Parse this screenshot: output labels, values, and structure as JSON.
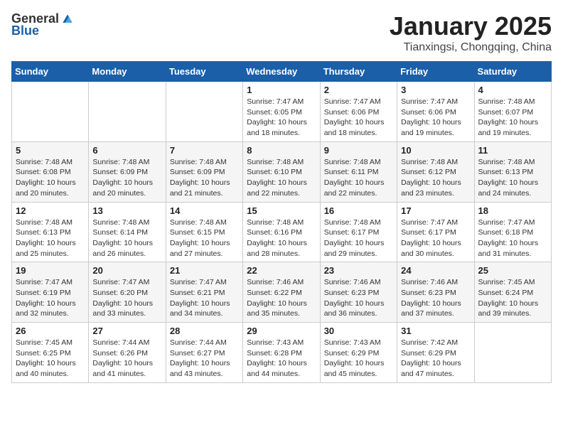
{
  "header": {
    "logo_general": "General",
    "logo_blue": "Blue",
    "month": "January 2025",
    "location": "Tianxingsi, Chongqing, China"
  },
  "weekdays": [
    "Sunday",
    "Monday",
    "Tuesday",
    "Wednesday",
    "Thursday",
    "Friday",
    "Saturday"
  ],
  "weeks": [
    [
      {
        "day": "",
        "info": ""
      },
      {
        "day": "",
        "info": ""
      },
      {
        "day": "",
        "info": ""
      },
      {
        "day": "1",
        "info": "Sunrise: 7:47 AM\nSunset: 6:05 PM\nDaylight: 10 hours\nand 18 minutes."
      },
      {
        "day": "2",
        "info": "Sunrise: 7:47 AM\nSunset: 6:06 PM\nDaylight: 10 hours\nand 18 minutes."
      },
      {
        "day": "3",
        "info": "Sunrise: 7:47 AM\nSunset: 6:06 PM\nDaylight: 10 hours\nand 19 minutes."
      },
      {
        "day": "4",
        "info": "Sunrise: 7:48 AM\nSunset: 6:07 PM\nDaylight: 10 hours\nand 19 minutes."
      }
    ],
    [
      {
        "day": "5",
        "info": "Sunrise: 7:48 AM\nSunset: 6:08 PM\nDaylight: 10 hours\nand 20 minutes."
      },
      {
        "day": "6",
        "info": "Sunrise: 7:48 AM\nSunset: 6:09 PM\nDaylight: 10 hours\nand 20 minutes."
      },
      {
        "day": "7",
        "info": "Sunrise: 7:48 AM\nSunset: 6:09 PM\nDaylight: 10 hours\nand 21 minutes."
      },
      {
        "day": "8",
        "info": "Sunrise: 7:48 AM\nSunset: 6:10 PM\nDaylight: 10 hours\nand 22 minutes."
      },
      {
        "day": "9",
        "info": "Sunrise: 7:48 AM\nSunset: 6:11 PM\nDaylight: 10 hours\nand 22 minutes."
      },
      {
        "day": "10",
        "info": "Sunrise: 7:48 AM\nSunset: 6:12 PM\nDaylight: 10 hours\nand 23 minutes."
      },
      {
        "day": "11",
        "info": "Sunrise: 7:48 AM\nSunset: 6:13 PM\nDaylight: 10 hours\nand 24 minutes."
      }
    ],
    [
      {
        "day": "12",
        "info": "Sunrise: 7:48 AM\nSunset: 6:13 PM\nDaylight: 10 hours\nand 25 minutes."
      },
      {
        "day": "13",
        "info": "Sunrise: 7:48 AM\nSunset: 6:14 PM\nDaylight: 10 hours\nand 26 minutes."
      },
      {
        "day": "14",
        "info": "Sunrise: 7:48 AM\nSunset: 6:15 PM\nDaylight: 10 hours\nand 27 minutes."
      },
      {
        "day": "15",
        "info": "Sunrise: 7:48 AM\nSunset: 6:16 PM\nDaylight: 10 hours\nand 28 minutes."
      },
      {
        "day": "16",
        "info": "Sunrise: 7:48 AM\nSunset: 6:17 PM\nDaylight: 10 hours\nand 29 minutes."
      },
      {
        "day": "17",
        "info": "Sunrise: 7:47 AM\nSunset: 6:17 PM\nDaylight: 10 hours\nand 30 minutes."
      },
      {
        "day": "18",
        "info": "Sunrise: 7:47 AM\nSunset: 6:18 PM\nDaylight: 10 hours\nand 31 minutes."
      }
    ],
    [
      {
        "day": "19",
        "info": "Sunrise: 7:47 AM\nSunset: 6:19 PM\nDaylight: 10 hours\nand 32 minutes."
      },
      {
        "day": "20",
        "info": "Sunrise: 7:47 AM\nSunset: 6:20 PM\nDaylight: 10 hours\nand 33 minutes."
      },
      {
        "day": "21",
        "info": "Sunrise: 7:47 AM\nSunset: 6:21 PM\nDaylight: 10 hours\nand 34 minutes."
      },
      {
        "day": "22",
        "info": "Sunrise: 7:46 AM\nSunset: 6:22 PM\nDaylight: 10 hours\nand 35 minutes."
      },
      {
        "day": "23",
        "info": "Sunrise: 7:46 AM\nSunset: 6:23 PM\nDaylight: 10 hours\nand 36 minutes."
      },
      {
        "day": "24",
        "info": "Sunrise: 7:46 AM\nSunset: 6:23 PM\nDaylight: 10 hours\nand 37 minutes."
      },
      {
        "day": "25",
        "info": "Sunrise: 7:45 AM\nSunset: 6:24 PM\nDaylight: 10 hours\nand 39 minutes."
      }
    ],
    [
      {
        "day": "26",
        "info": "Sunrise: 7:45 AM\nSunset: 6:25 PM\nDaylight: 10 hours\nand 40 minutes."
      },
      {
        "day": "27",
        "info": "Sunrise: 7:44 AM\nSunset: 6:26 PM\nDaylight: 10 hours\nand 41 minutes."
      },
      {
        "day": "28",
        "info": "Sunrise: 7:44 AM\nSunset: 6:27 PM\nDaylight: 10 hours\nand 43 minutes."
      },
      {
        "day": "29",
        "info": "Sunrise: 7:43 AM\nSunset: 6:28 PM\nDaylight: 10 hours\nand 44 minutes."
      },
      {
        "day": "30",
        "info": "Sunrise: 7:43 AM\nSunset: 6:29 PM\nDaylight: 10 hours\nand 45 minutes."
      },
      {
        "day": "31",
        "info": "Sunrise: 7:42 AM\nSunset: 6:29 PM\nDaylight: 10 hours\nand 47 minutes."
      },
      {
        "day": "",
        "info": ""
      }
    ]
  ]
}
